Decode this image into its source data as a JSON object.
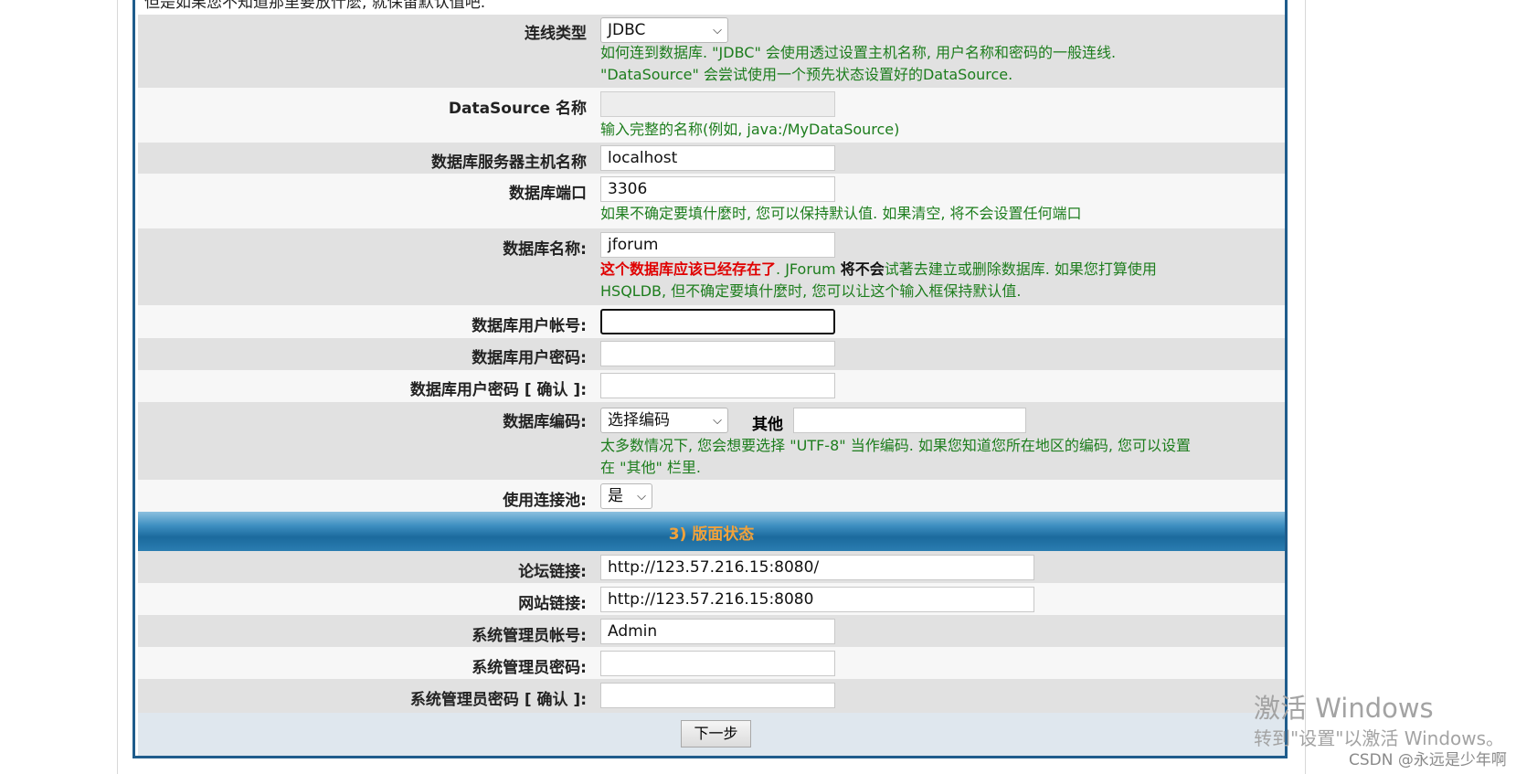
{
  "top_text": "但是如果您不知道那里要放什麽, 就保留默认值吧.",
  "connection_type": {
    "label": "连线类型",
    "value": "JDBC",
    "help_line1": "如何连到数据库. \"JDBC\" 会使用透过设置主机名称, 用户名称和密码的一般连线.",
    "help_line2": "\"DataSource\" 会尝试使用一个预先状态设置好的DataSource."
  },
  "datasource": {
    "label": "DataSource 名称",
    "value": "",
    "help": "输入完整的名称(例如, java:/MyDataSource)"
  },
  "db_host": {
    "label": "数据库服务器主机名称",
    "value": "localhost"
  },
  "db_port": {
    "label": "数据库端口",
    "value": "3306",
    "help": "如果不确定要填什麼时, 您可以保持默认值. 如果清空, 将不会设置任何端口"
  },
  "db_name": {
    "label": "数据库名称:",
    "value": "jforum",
    "help_red": "这个数据库应该已经存在了",
    "help_mid": ". JForum ",
    "help_bold": "将不会",
    "help_rest": "试著去建立或删除数据库. 如果您打算使用",
    "help_line2": "HSQLDB, 但不确定要填什麼时, 您可以让这个输入框保持默认值."
  },
  "db_user": {
    "label": "数据库用户帐号:",
    "value": ""
  },
  "db_pass": {
    "label": "数据库用户密码:",
    "value": ""
  },
  "db_pass_confirm": {
    "label": "数据库用户密码 [ 确认 ]:",
    "value": ""
  },
  "db_encoding": {
    "label": "数据库编码:",
    "select_value": "选择编码",
    "other_label": "其他",
    "other_value": "",
    "help_line1": "太多数情况下, 您会想要选择 \"UTF-8\" 当作编码. 如果您知道您所在地区的编码, 您可以设置",
    "help_line2": "在 \"其他\" 栏里."
  },
  "pool": {
    "label": "使用连接池:",
    "value": "是"
  },
  "section_title": "3) 版面状态",
  "forum_link": {
    "label": "论坛链接:",
    "value": "http://123.57.216.15:8080/"
  },
  "site_link": {
    "label": "网站链接:",
    "value": "http://123.57.216.15:8080"
  },
  "admin_user": {
    "label": "系统管理员帐号:",
    "value": "Admin"
  },
  "admin_pass": {
    "label": "系统管理员密码:",
    "value": ""
  },
  "admin_pass_confirm": {
    "label": "系统管理员密码 [ 确认 ]:",
    "value": ""
  },
  "next_button": "下一步",
  "watermark": {
    "line1": "激活 Windows",
    "line2": "转到\"设置\"以激活 Windows。",
    "credit": "CSDN @永远是少年啊"
  },
  "colors": {
    "frame": "#1f5c8c",
    "row_alt": "#e1e1e1",
    "help_text": "#1d7d1d",
    "warning": "#e00000",
    "section_text": "#f2a23a"
  }
}
